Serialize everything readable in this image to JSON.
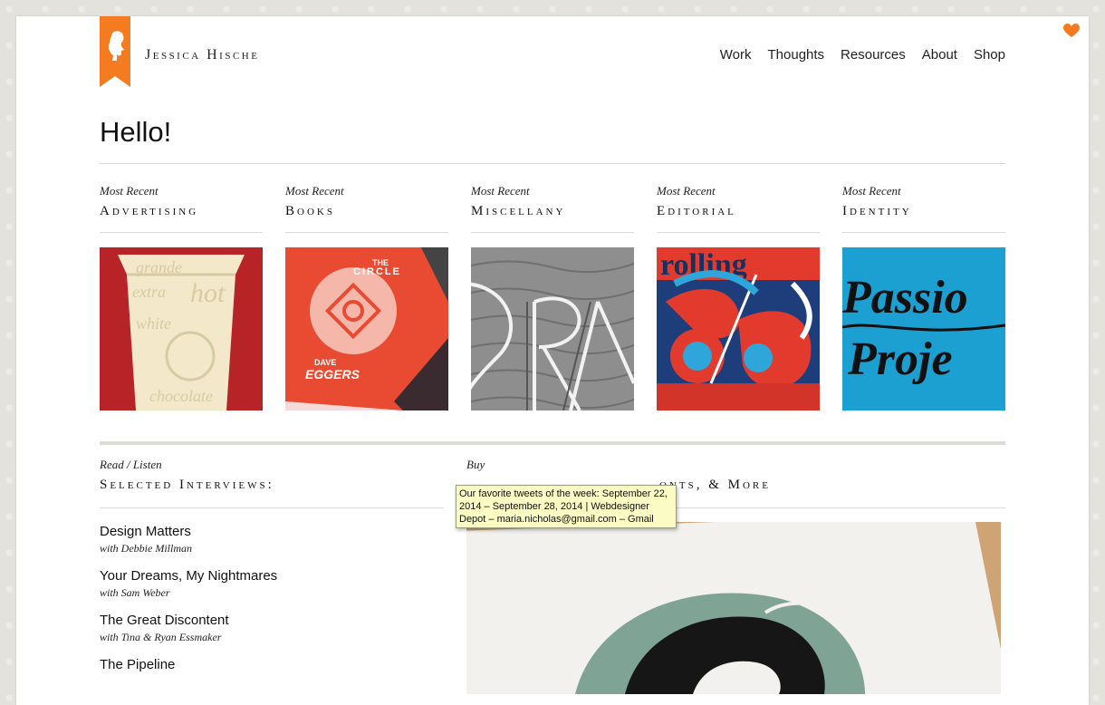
{
  "header": {
    "site_name_first": "Jessica",
    "site_name_last": "Hische",
    "nav": [
      "Work",
      "Thoughts",
      "Resources",
      "About",
      "Shop"
    ]
  },
  "colors": {
    "brand_orange": "#f47b20",
    "rule": "#d9d9d5"
  },
  "hello": "Hello!",
  "recent": {
    "kicker": "Most Recent",
    "categories": [
      "Advertising",
      "Books",
      "Miscellany",
      "Editorial",
      "Identity"
    ]
  },
  "thumbnails": {
    "advertising": [
      "grande",
      "extra",
      "hot",
      "white",
      "chocolate"
    ],
    "books": [
      "THE",
      "CIRCLE",
      "DAVE",
      "EGGERS"
    ],
    "identity": [
      "Passio",
      "Proje"
    ]
  },
  "interviews": {
    "kicker": "Read / Listen",
    "title": "Selected Interviews:",
    "items": [
      {
        "title": "Design Matters",
        "with": "with Debbie Millman"
      },
      {
        "title": "Your Dreams, My Nightmares",
        "with": "with Sam Weber"
      },
      {
        "title": "The Great Discontent",
        "with": "with Tina & Ryan Essmaker"
      },
      {
        "title": "The Pipeline",
        "with": ""
      }
    ]
  },
  "shop": {
    "kicker": "Buy",
    "title_visible": "onts, & More"
  },
  "tooltip": {
    "text": "Our favorite tweets of the week: September 22, 2014 – September 28, 2014 | Webdesigner Depot – maria.nicholas@gmail.com – Gmail"
  },
  "icons": [
    "heart-icon",
    "logo-silhouette-icon"
  ]
}
